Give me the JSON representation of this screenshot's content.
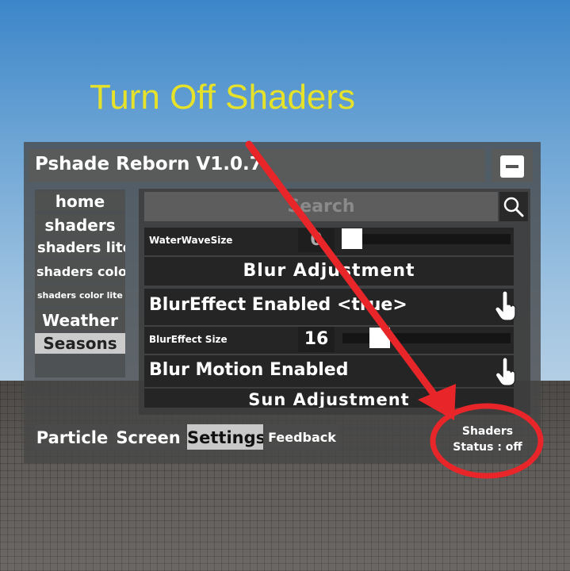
{
  "annotation": {
    "caption": "Turn Off Shaders",
    "caption_color": "#e6e22a",
    "arrow_color": "#e8262a"
  },
  "window": {
    "title": "Pshade Reborn V1.0.7",
    "minimize_icon": "minus-icon"
  },
  "sidebar": {
    "items": [
      {
        "label": "home"
      },
      {
        "label": "shaders"
      },
      {
        "label": "shaders lite"
      },
      {
        "label": "shaders color"
      },
      {
        "label": "shaders color lite"
      },
      {
        "label": "Weather"
      },
      {
        "label": "Seasons"
      }
    ],
    "active": "Seasons"
  },
  "search": {
    "placeholder": "Search",
    "icon": "search-icon"
  },
  "settings": {
    "water_wave_size": {
      "label": "WaterWaveSize",
      "value": "0",
      "fraction": 0.0
    },
    "blur_heading": "Blur Adjustment",
    "blur_effect": {
      "label": "BlurEffect Enabled <true>",
      "icon": "hand-pointer-icon"
    },
    "blur_size": {
      "label": "BlurEffect Size",
      "value": "16",
      "fraction": 0.16
    },
    "blur_motion": {
      "label": "Blur Motion Enabled",
      "icon": "hand-pointer-icon"
    },
    "sun_heading": "Sun Adjustment"
  },
  "tabs": [
    {
      "label": "Particle"
    },
    {
      "label": "Screen"
    },
    {
      "label": "Settings"
    },
    {
      "label": "Feedback"
    }
  ],
  "active_tab": "Settings",
  "status": {
    "line1": "Shaders",
    "line2": "Status : off"
  }
}
